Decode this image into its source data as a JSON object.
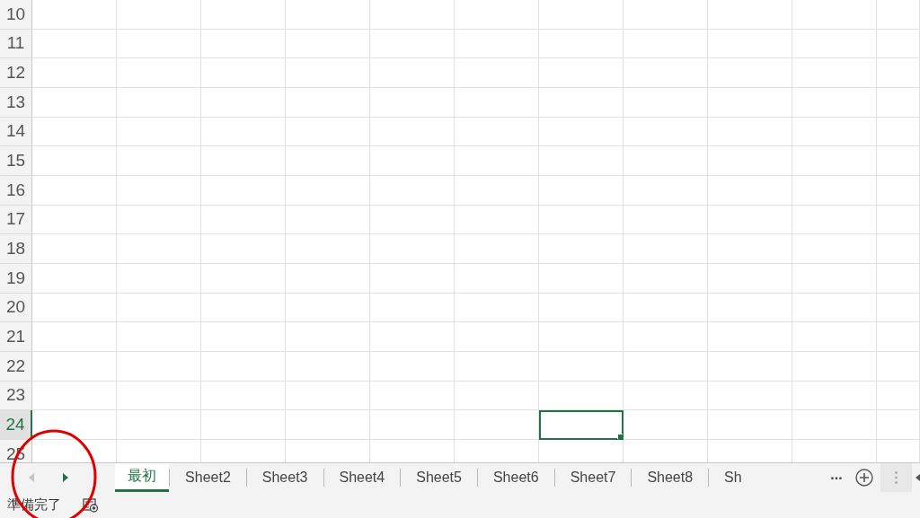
{
  "sheet": {
    "rows": [
      {
        "label": "10",
        "selected": false,
        "cells": [
          {
            "selected": false
          },
          {
            "selected": false
          },
          {
            "selected": false
          },
          {
            "selected": false
          },
          {
            "selected": false
          },
          {
            "selected": false
          },
          {
            "selected": false
          },
          {
            "selected": false
          },
          {
            "selected": false
          },
          {
            "selected": false
          },
          {
            "selected": false
          }
        ]
      },
      {
        "label": "11",
        "selected": false,
        "cells": [
          {
            "selected": false
          },
          {
            "selected": false
          },
          {
            "selected": false
          },
          {
            "selected": false
          },
          {
            "selected": false
          },
          {
            "selected": false
          },
          {
            "selected": false
          },
          {
            "selected": false
          },
          {
            "selected": false
          },
          {
            "selected": false
          },
          {
            "selected": false
          }
        ]
      },
      {
        "label": "12",
        "selected": false,
        "cells": [
          {
            "selected": false
          },
          {
            "selected": false
          },
          {
            "selected": false
          },
          {
            "selected": false
          },
          {
            "selected": false
          },
          {
            "selected": false
          },
          {
            "selected": false
          },
          {
            "selected": false
          },
          {
            "selected": false
          },
          {
            "selected": false
          },
          {
            "selected": false
          }
        ]
      },
      {
        "label": "13",
        "selected": false,
        "cells": [
          {
            "selected": false
          },
          {
            "selected": false
          },
          {
            "selected": false
          },
          {
            "selected": false
          },
          {
            "selected": false
          },
          {
            "selected": false
          },
          {
            "selected": false
          },
          {
            "selected": false
          },
          {
            "selected": false
          },
          {
            "selected": false
          },
          {
            "selected": false
          }
        ]
      },
      {
        "label": "14",
        "selected": false,
        "cells": [
          {
            "selected": false
          },
          {
            "selected": false
          },
          {
            "selected": false
          },
          {
            "selected": false
          },
          {
            "selected": false
          },
          {
            "selected": false
          },
          {
            "selected": false
          },
          {
            "selected": false
          },
          {
            "selected": false
          },
          {
            "selected": false
          },
          {
            "selected": false
          }
        ]
      },
      {
        "label": "15",
        "selected": false,
        "cells": [
          {
            "selected": false
          },
          {
            "selected": false
          },
          {
            "selected": false
          },
          {
            "selected": false
          },
          {
            "selected": false
          },
          {
            "selected": false
          },
          {
            "selected": false
          },
          {
            "selected": false
          },
          {
            "selected": false
          },
          {
            "selected": false
          },
          {
            "selected": false
          }
        ]
      },
      {
        "label": "16",
        "selected": false,
        "cells": [
          {
            "selected": false
          },
          {
            "selected": false
          },
          {
            "selected": false
          },
          {
            "selected": false
          },
          {
            "selected": false
          },
          {
            "selected": false
          },
          {
            "selected": false
          },
          {
            "selected": false
          },
          {
            "selected": false
          },
          {
            "selected": false
          },
          {
            "selected": false
          }
        ]
      },
      {
        "label": "17",
        "selected": false,
        "cells": [
          {
            "selected": false
          },
          {
            "selected": false
          },
          {
            "selected": false
          },
          {
            "selected": false
          },
          {
            "selected": false
          },
          {
            "selected": false
          },
          {
            "selected": false
          },
          {
            "selected": false
          },
          {
            "selected": false
          },
          {
            "selected": false
          },
          {
            "selected": false
          }
        ]
      },
      {
        "label": "18",
        "selected": false,
        "cells": [
          {
            "selected": false
          },
          {
            "selected": false
          },
          {
            "selected": false
          },
          {
            "selected": false
          },
          {
            "selected": false
          },
          {
            "selected": false
          },
          {
            "selected": false
          },
          {
            "selected": false
          },
          {
            "selected": false
          },
          {
            "selected": false
          },
          {
            "selected": false
          }
        ]
      },
      {
        "label": "19",
        "selected": false,
        "cells": [
          {
            "selected": false
          },
          {
            "selected": false
          },
          {
            "selected": false
          },
          {
            "selected": false
          },
          {
            "selected": false
          },
          {
            "selected": false
          },
          {
            "selected": false
          },
          {
            "selected": false
          },
          {
            "selected": false
          },
          {
            "selected": false
          },
          {
            "selected": false
          }
        ]
      },
      {
        "label": "20",
        "selected": false,
        "cells": [
          {
            "selected": false
          },
          {
            "selected": false
          },
          {
            "selected": false
          },
          {
            "selected": false
          },
          {
            "selected": false
          },
          {
            "selected": false
          },
          {
            "selected": false
          },
          {
            "selected": false
          },
          {
            "selected": false
          },
          {
            "selected": false
          },
          {
            "selected": false
          }
        ]
      },
      {
        "label": "21",
        "selected": false,
        "cells": [
          {
            "selected": false
          },
          {
            "selected": false
          },
          {
            "selected": false
          },
          {
            "selected": false
          },
          {
            "selected": false
          },
          {
            "selected": false
          },
          {
            "selected": false
          },
          {
            "selected": false
          },
          {
            "selected": false
          },
          {
            "selected": false
          },
          {
            "selected": false
          }
        ]
      },
      {
        "label": "22",
        "selected": false,
        "cells": [
          {
            "selected": false
          },
          {
            "selected": false
          },
          {
            "selected": false
          },
          {
            "selected": false
          },
          {
            "selected": false
          },
          {
            "selected": false
          },
          {
            "selected": false
          },
          {
            "selected": false
          },
          {
            "selected": false
          },
          {
            "selected": false
          },
          {
            "selected": false
          }
        ]
      },
      {
        "label": "23",
        "selected": false,
        "cells": [
          {
            "selected": false
          },
          {
            "selected": false
          },
          {
            "selected": false
          },
          {
            "selected": false
          },
          {
            "selected": false
          },
          {
            "selected": false
          },
          {
            "selected": false
          },
          {
            "selected": false
          },
          {
            "selected": false
          },
          {
            "selected": false
          },
          {
            "selected": false
          }
        ]
      },
      {
        "label": "24",
        "selected": true,
        "cells": [
          {
            "selected": false
          },
          {
            "selected": false
          },
          {
            "selected": false
          },
          {
            "selected": false
          },
          {
            "selected": false
          },
          {
            "selected": false
          },
          {
            "selected": true
          },
          {
            "selected": false
          },
          {
            "selected": false
          },
          {
            "selected": false
          },
          {
            "selected": false
          }
        ]
      },
      {
        "label": "25",
        "selected": false,
        "cells": [
          {
            "selected": false
          },
          {
            "selected": false
          },
          {
            "selected": false
          },
          {
            "selected": false
          },
          {
            "selected": false
          },
          {
            "selected": false
          },
          {
            "selected": false
          },
          {
            "selected": false
          },
          {
            "selected": false
          },
          {
            "selected": false
          },
          {
            "selected": false
          }
        ]
      }
    ]
  },
  "sheet_tabs": {
    "scroll_left": {
      "disabled": true
    },
    "scroll_right": {
      "disabled": false
    },
    "tabs": [
      {
        "label": "最初",
        "selected": true
      },
      {
        "label": "Sheet2",
        "selected": false
      },
      {
        "label": "Sheet3",
        "selected": false
      },
      {
        "label": "Sheet4",
        "selected": false
      },
      {
        "label": "Sheet5",
        "selected": false
      },
      {
        "label": "Sheet6",
        "selected": false
      },
      {
        "label": "Sheet7",
        "selected": false
      },
      {
        "label": "Sheet8",
        "selected": false
      },
      {
        "label": "Sh",
        "selected": false
      }
    ],
    "more": "..."
  },
  "annotation": {
    "kind": "circle",
    "color": "#e00000"
  },
  "status_bar": {
    "text": "準備完了"
  }
}
